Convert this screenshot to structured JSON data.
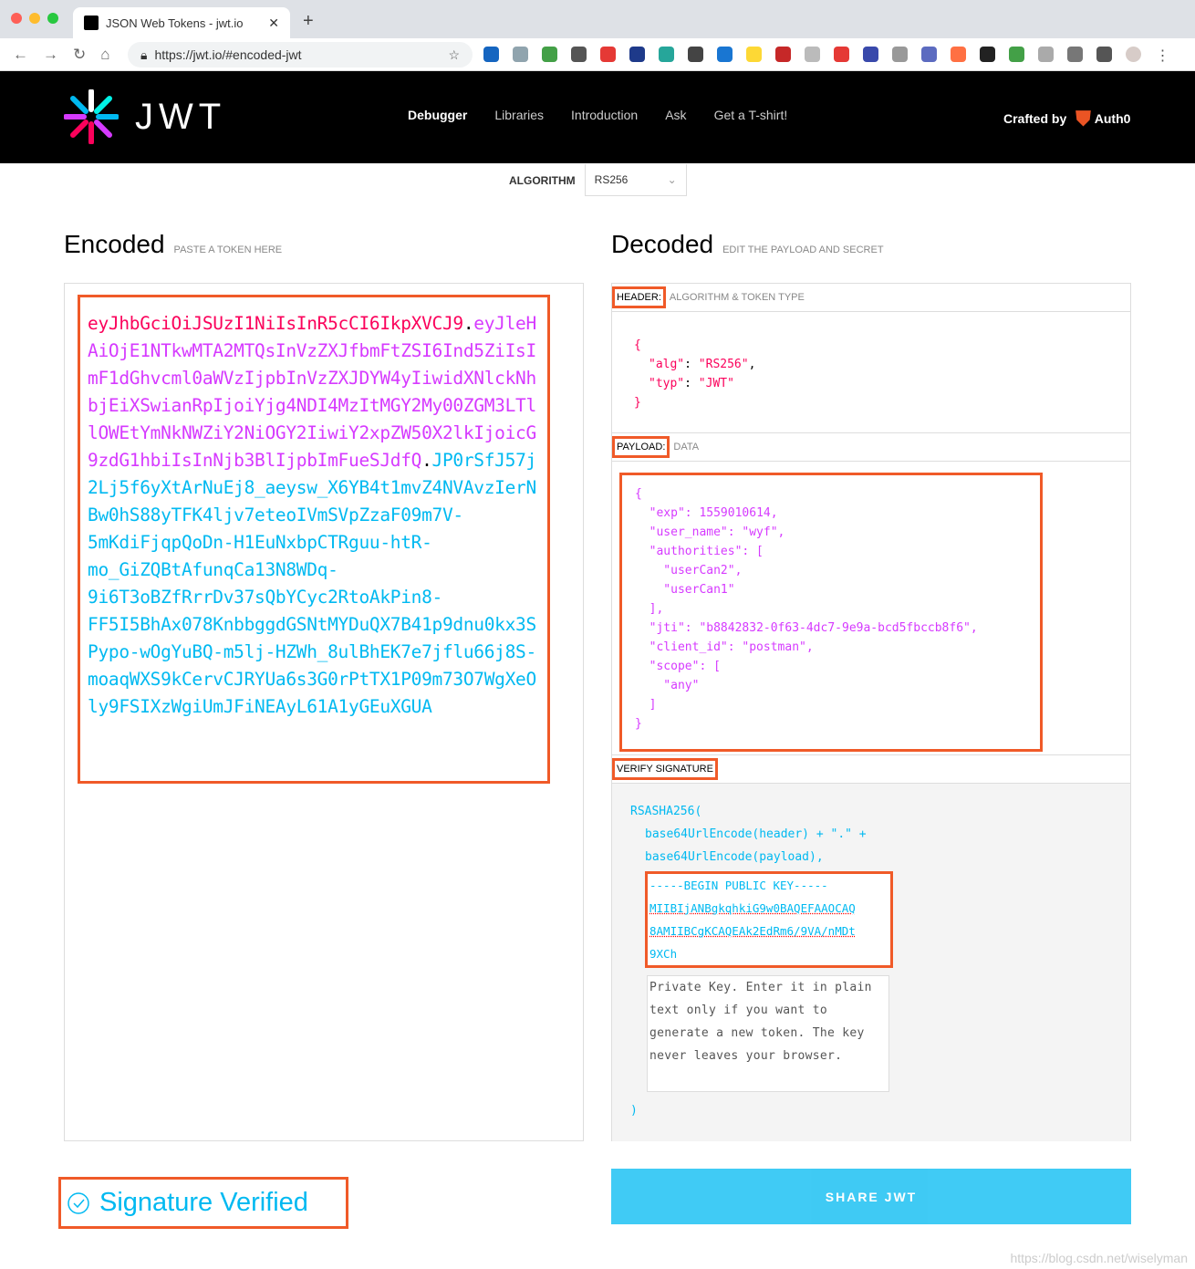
{
  "browser": {
    "tab_title": "JSON Web Tokens - jwt.io",
    "url": "https://jwt.io/#encoded-jwt"
  },
  "nav": {
    "items": [
      "Debugger",
      "Libraries",
      "Introduction",
      "Ask",
      "Get a T-shirt!"
    ],
    "crafted_by": "Crafted by",
    "brand": "Auth0",
    "logo_text": "JWT"
  },
  "algorithm": {
    "label": "ALGORITHM",
    "value": "RS256"
  },
  "encoded": {
    "title": "Encoded",
    "subtitle": "PASTE A TOKEN HERE",
    "header": "eyJhbGciOiJSUzI1NiIsInR5cCI6IkpXVCJ9",
    "payload": "eyJleHAiOjE1NTkwMTA2MTQsInVzZXJfbmFtZSI6Ind5ZiIsImF1dGhvcml0aWVzIjpbInVzZXJDYW4yIiwidXNlckNhbjEiXSwianRpIjoiYjg4NDI4MzItMGY2My00ZGM3LTllOWEtYmNkNWZiY2NiOGY2IiwiY2xpZW50X2lkIjoicG9zdG1hbiIsInNjb3BlIjpbImFueSJdfQ",
    "signature": "JP0rSfJ57j2Lj5f6yXtArNuEj8_aeysw_X6YB4t1mvZ4NVAvzIerNBw0hS88yTFK4ljv7eteoIVmSVpZzaF09m7V-5mKdiFjqpQoDn-H1EuNxbpCTRguu-htR-mo_GiZQBtAfunqCa13N8WDq-9i6T3oBZfRrrDv37sQbYCyc2RtoAkPin8-FF5I5BhAx078KnbbggdGSNtMYDuQX7B41p9dnu0kx3SPypo-wOgYuBQ-m5lj-HZWh_8ulBhEK7e7jflu66j8S-moaqWXS9kCervCJRYUa6s3G0rPtTX1P09m73O7WgXeOly9FSIXzWgiUmJFiNEAyL61A1yGEuXGUA",
    "dot": "."
  },
  "decoded": {
    "title": "Decoded",
    "subtitle": "EDIT THE PAYLOAD AND SECRET",
    "header_label": "HEADER:",
    "header_desc": "ALGORITHM & TOKEN TYPE",
    "payload_label": "PAYLOAD:",
    "payload_desc": "DATA",
    "verify_label": "VERIFY SIGNATURE",
    "header_json": {
      "alg": "RS256",
      "typ": "JWT"
    },
    "payload_json": {
      "exp": "1559010614",
      "user_name": "wyf",
      "authorities": [
        "userCan2",
        "userCan1"
      ],
      "jti": "b8842832-0f63-4dc7-9e9a-bcd5fbccb8f6",
      "client_id": "postman",
      "scope": [
        "any"
      ]
    },
    "verify": {
      "fn": "RSASHA256(",
      "line1": "base64UrlEncode(header) + \".\" +",
      "line2": "base64UrlEncode(payload),",
      "public_key": [
        "-----BEGIN PUBLIC KEY-----",
        "MIIBIjANBgkqhkiG9w0BAQEFAAOCAQ",
        "8AMIIBCgKCAQEAk2EdRm6/9VA/nMDt",
        "9XCh"
      ],
      "private_key_placeholder": "Private Key. Enter it in plain text only if you want to generate a new token. The key never leaves your browser.",
      "close": ")"
    }
  },
  "status": {
    "verified": "Signature Verified"
  },
  "share_button": "SHARE JWT",
  "watermark": "https://blog.csdn.net/wiselyman",
  "colors": {
    "header": "#fb015b",
    "payload": "#d63aff",
    "signature": "#00b9f1",
    "highlight": "#f05a28"
  }
}
